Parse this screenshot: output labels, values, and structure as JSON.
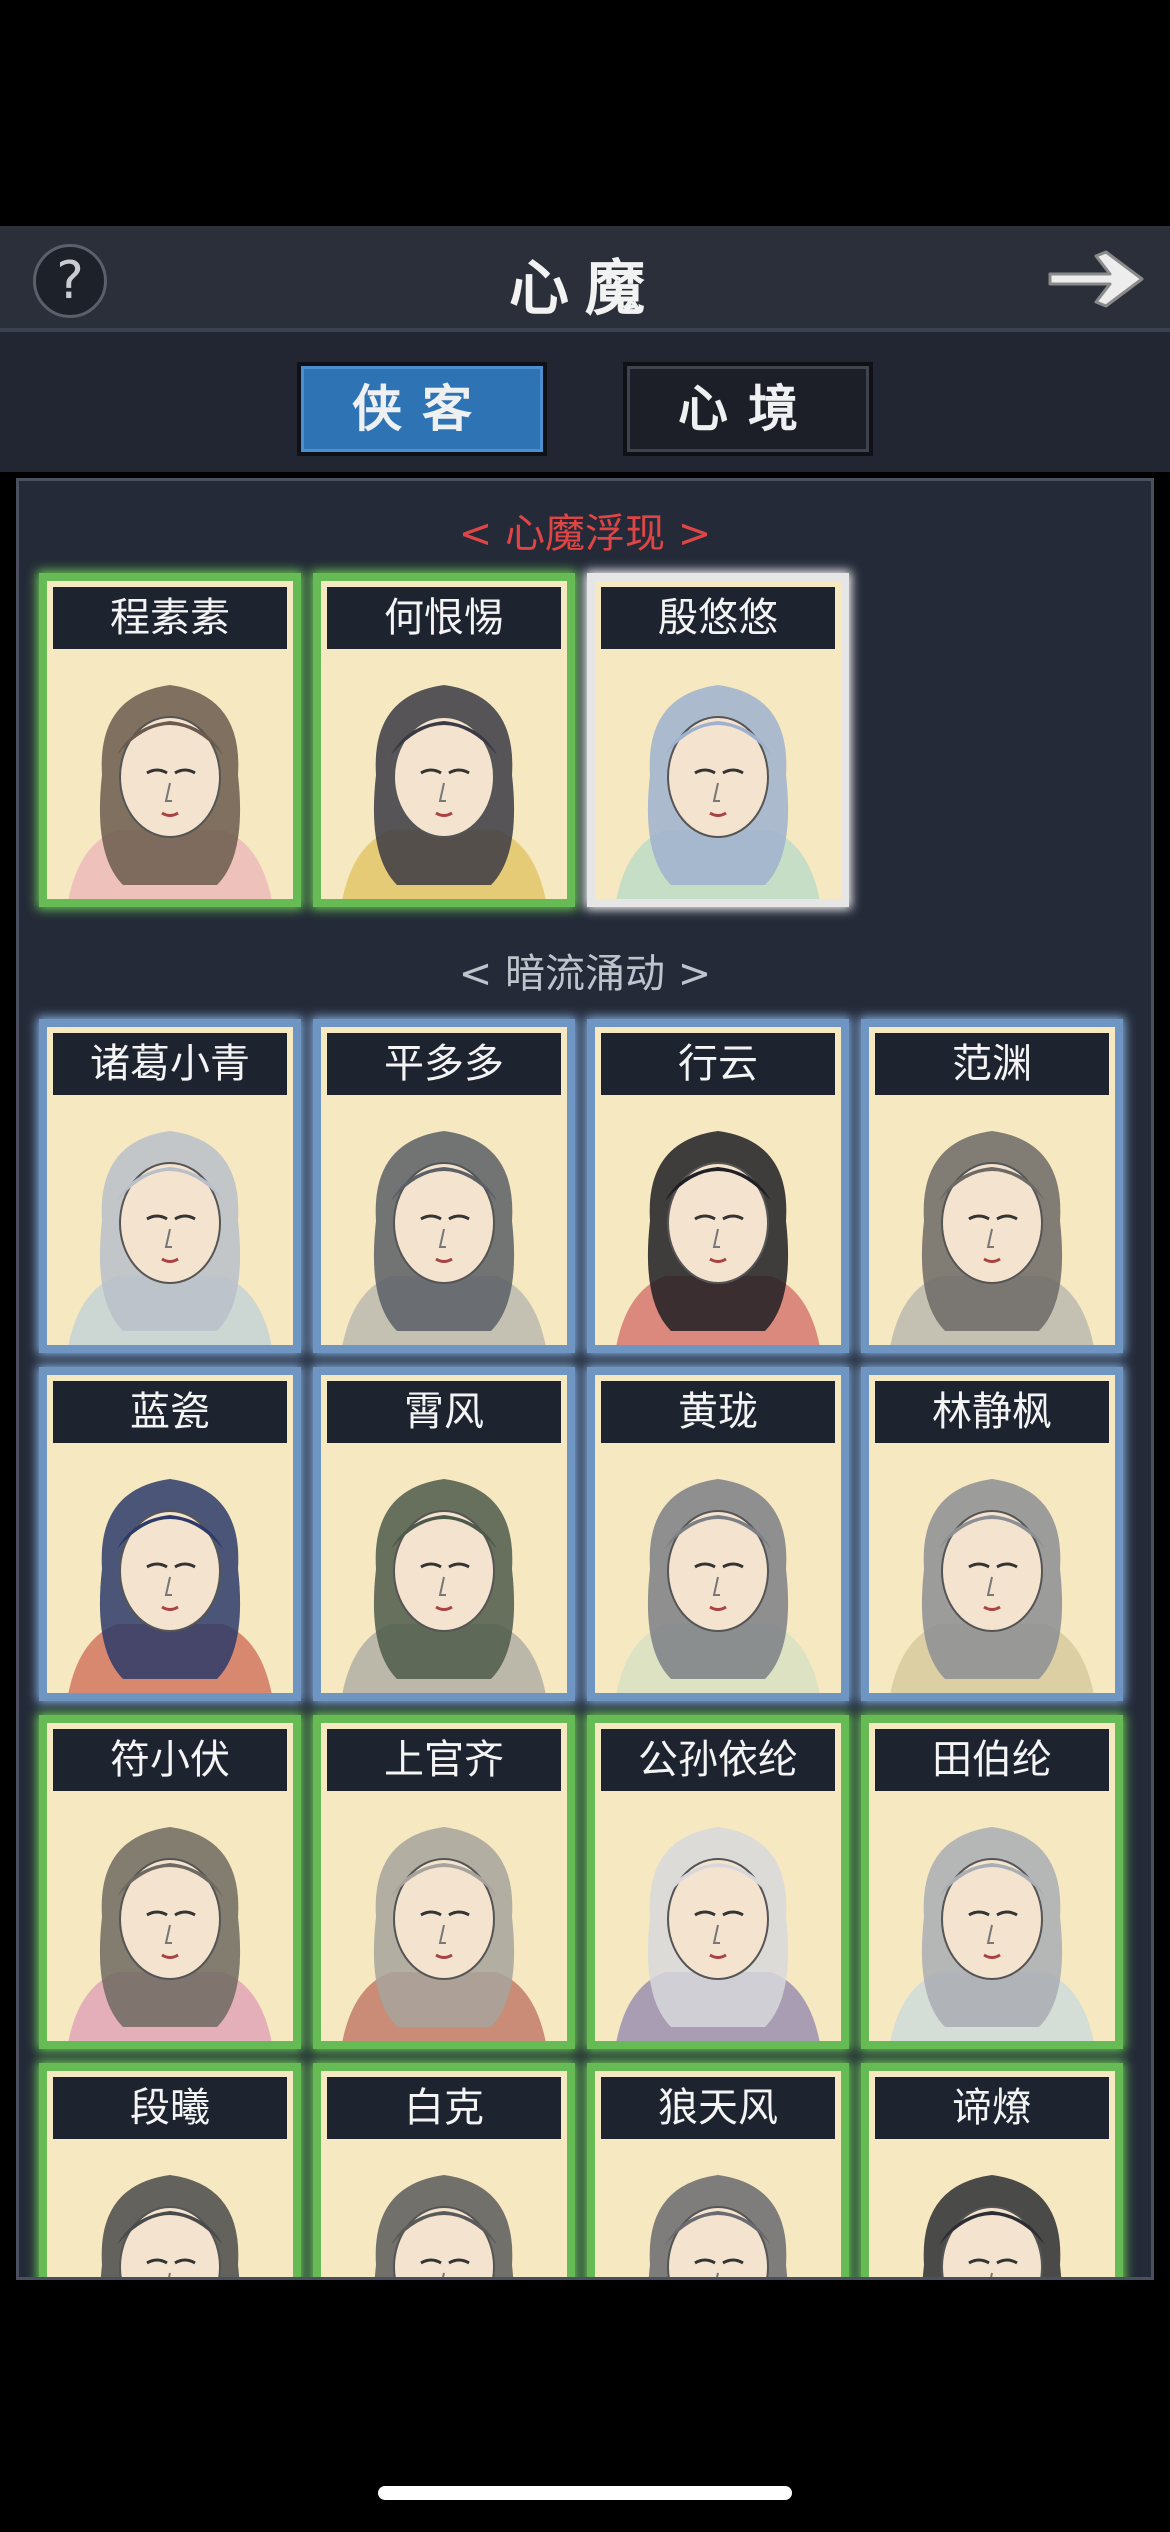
{
  "header": {
    "help_glyph": "?",
    "title": "心魔",
    "help_icon": "question-circle-icon",
    "next_icon": "arrow-right-icon"
  },
  "tabs": [
    {
      "label": "侠客",
      "active": true
    },
    {
      "label": "心境",
      "active": false
    }
  ],
  "sections": {
    "emerging": {
      "title": "< 心魔浮现 >",
      "color": "#e04545",
      "cards": [
        {
          "name": "程素素",
          "frame": "green",
          "hair": "#6b5a4e",
          "accent": "#e8a3b6"
        },
        {
          "name": "何恨惕",
          "frame": "green",
          "hair": "#3a3a44",
          "accent": "#d9b338"
        },
        {
          "name": "殷悠悠",
          "frame": "white",
          "hair": "#9fb1cf",
          "accent": "#9cd5c8"
        }
      ]
    },
    "undercurrent": {
      "title": "< 暗流涌动 >",
      "cards": [
        {
          "name": "诸葛小青",
          "frame": "blue",
          "hair": "#b9bfc9",
          "accent": "#a9c7e0"
        },
        {
          "name": "平多多",
          "frame": "blue",
          "hair": "#5b5f66",
          "accent": "#9aa0a8"
        },
        {
          "name": "行云",
          "frame": "blue",
          "hair": "#1f1f24",
          "accent": "#c43b44"
        },
        {
          "name": "范渊",
          "frame": "blue",
          "hair": "#6d6a66",
          "accent": "#9aa0a8"
        },
        {
          "name": "蓝瓷",
          "frame": "blue",
          "hair": "#2d3b6a",
          "accent": "#c0392b"
        },
        {
          "name": "霄风",
          "frame": "blue",
          "hair": "#4d5a4a",
          "accent": "#8c8f95"
        },
        {
          "name": "黄珑",
          "frame": "blue",
          "hair": "#7c7f86",
          "accent": "#c9dcc4"
        },
        {
          "name": "林静枫",
          "frame": "blue",
          "hair": "#8c8f94",
          "accent": "#c8b98c"
        },
        {
          "name": "符小伏",
          "frame": "green",
          "hair": "#6e6a62",
          "accent": "#d67fb0"
        },
        {
          "name": "上官齐",
          "frame": "green",
          "hair": "#a7a39c",
          "accent": "#a5403a"
        },
        {
          "name": "公孙依纶",
          "frame": "green",
          "hair": "#d8d8dc",
          "accent": "#6a5fa8"
        },
        {
          "name": "田伯纶",
          "frame": "green",
          "hair": "#a9adb4",
          "accent": "#b9d4ea"
        },
        {
          "name": "段曦",
          "frame": "green",
          "hair": "#4a4a4a",
          "accent": "#9aa0a8"
        },
        {
          "name": "白克",
          "frame": "green",
          "hair": "#5a5a5a",
          "accent": "#9aa0a8"
        },
        {
          "name": "狼天风",
          "frame": "green",
          "hair": "#6a6a70",
          "accent": "#9aa0a8"
        },
        {
          "name": "谛燎",
          "frame": "green",
          "hair": "#2c2e33",
          "accent": "#9aa0a8"
        }
      ]
    }
  }
}
